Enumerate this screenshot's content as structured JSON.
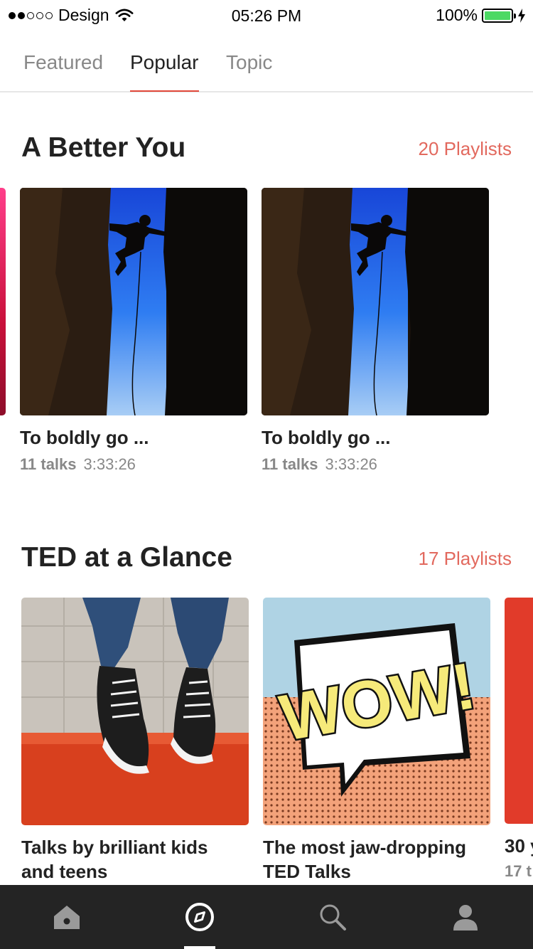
{
  "status_bar": {
    "carrier": "Design",
    "time": "05:26 PM",
    "battery": "100%",
    "battery_level": 1.0,
    "signal_strength": 2,
    "signal_max": 5
  },
  "tabs": [
    {
      "label": "Featured",
      "active": false
    },
    {
      "label": "Popular",
      "active": true
    },
    {
      "label": "Topic",
      "active": false
    }
  ],
  "sections": [
    {
      "title": "A Better You",
      "count": "20 Playlists",
      "cards": [
        {
          "title": "To boldly go ...",
          "talks": "11 talks",
          "duration": "3:33:26",
          "image": "climber"
        },
        {
          "title": "To boldly go ...",
          "talks": "11 talks",
          "duration": "3:33:26",
          "image": "climber"
        }
      ]
    },
    {
      "title": "TED at a Glance",
      "count": "17 Playlists",
      "cards": [
        {
          "title_line1": "Talks by brilliant kids",
          "title_line2": "and teens",
          "image": "sneakers"
        },
        {
          "title_line1": "The most jaw-dropping",
          "title_line2": "TED Talks",
          "image": "wow",
          "wow_text": "WOW!"
        }
      ],
      "peek": {
        "title": "30 y",
        "meta": "17 t"
      }
    }
  ],
  "bottom_nav": [
    {
      "icon": "home-icon",
      "active": false
    },
    {
      "icon": "explore-compass-icon",
      "active": true
    },
    {
      "icon": "search-icon",
      "active": false
    },
    {
      "icon": "profile-icon",
      "active": false
    }
  ],
  "colors": {
    "accent": "#e2483a",
    "count_text": "#e2695e",
    "nav_bg": "#242424",
    "battery_green": "#4cd964"
  }
}
